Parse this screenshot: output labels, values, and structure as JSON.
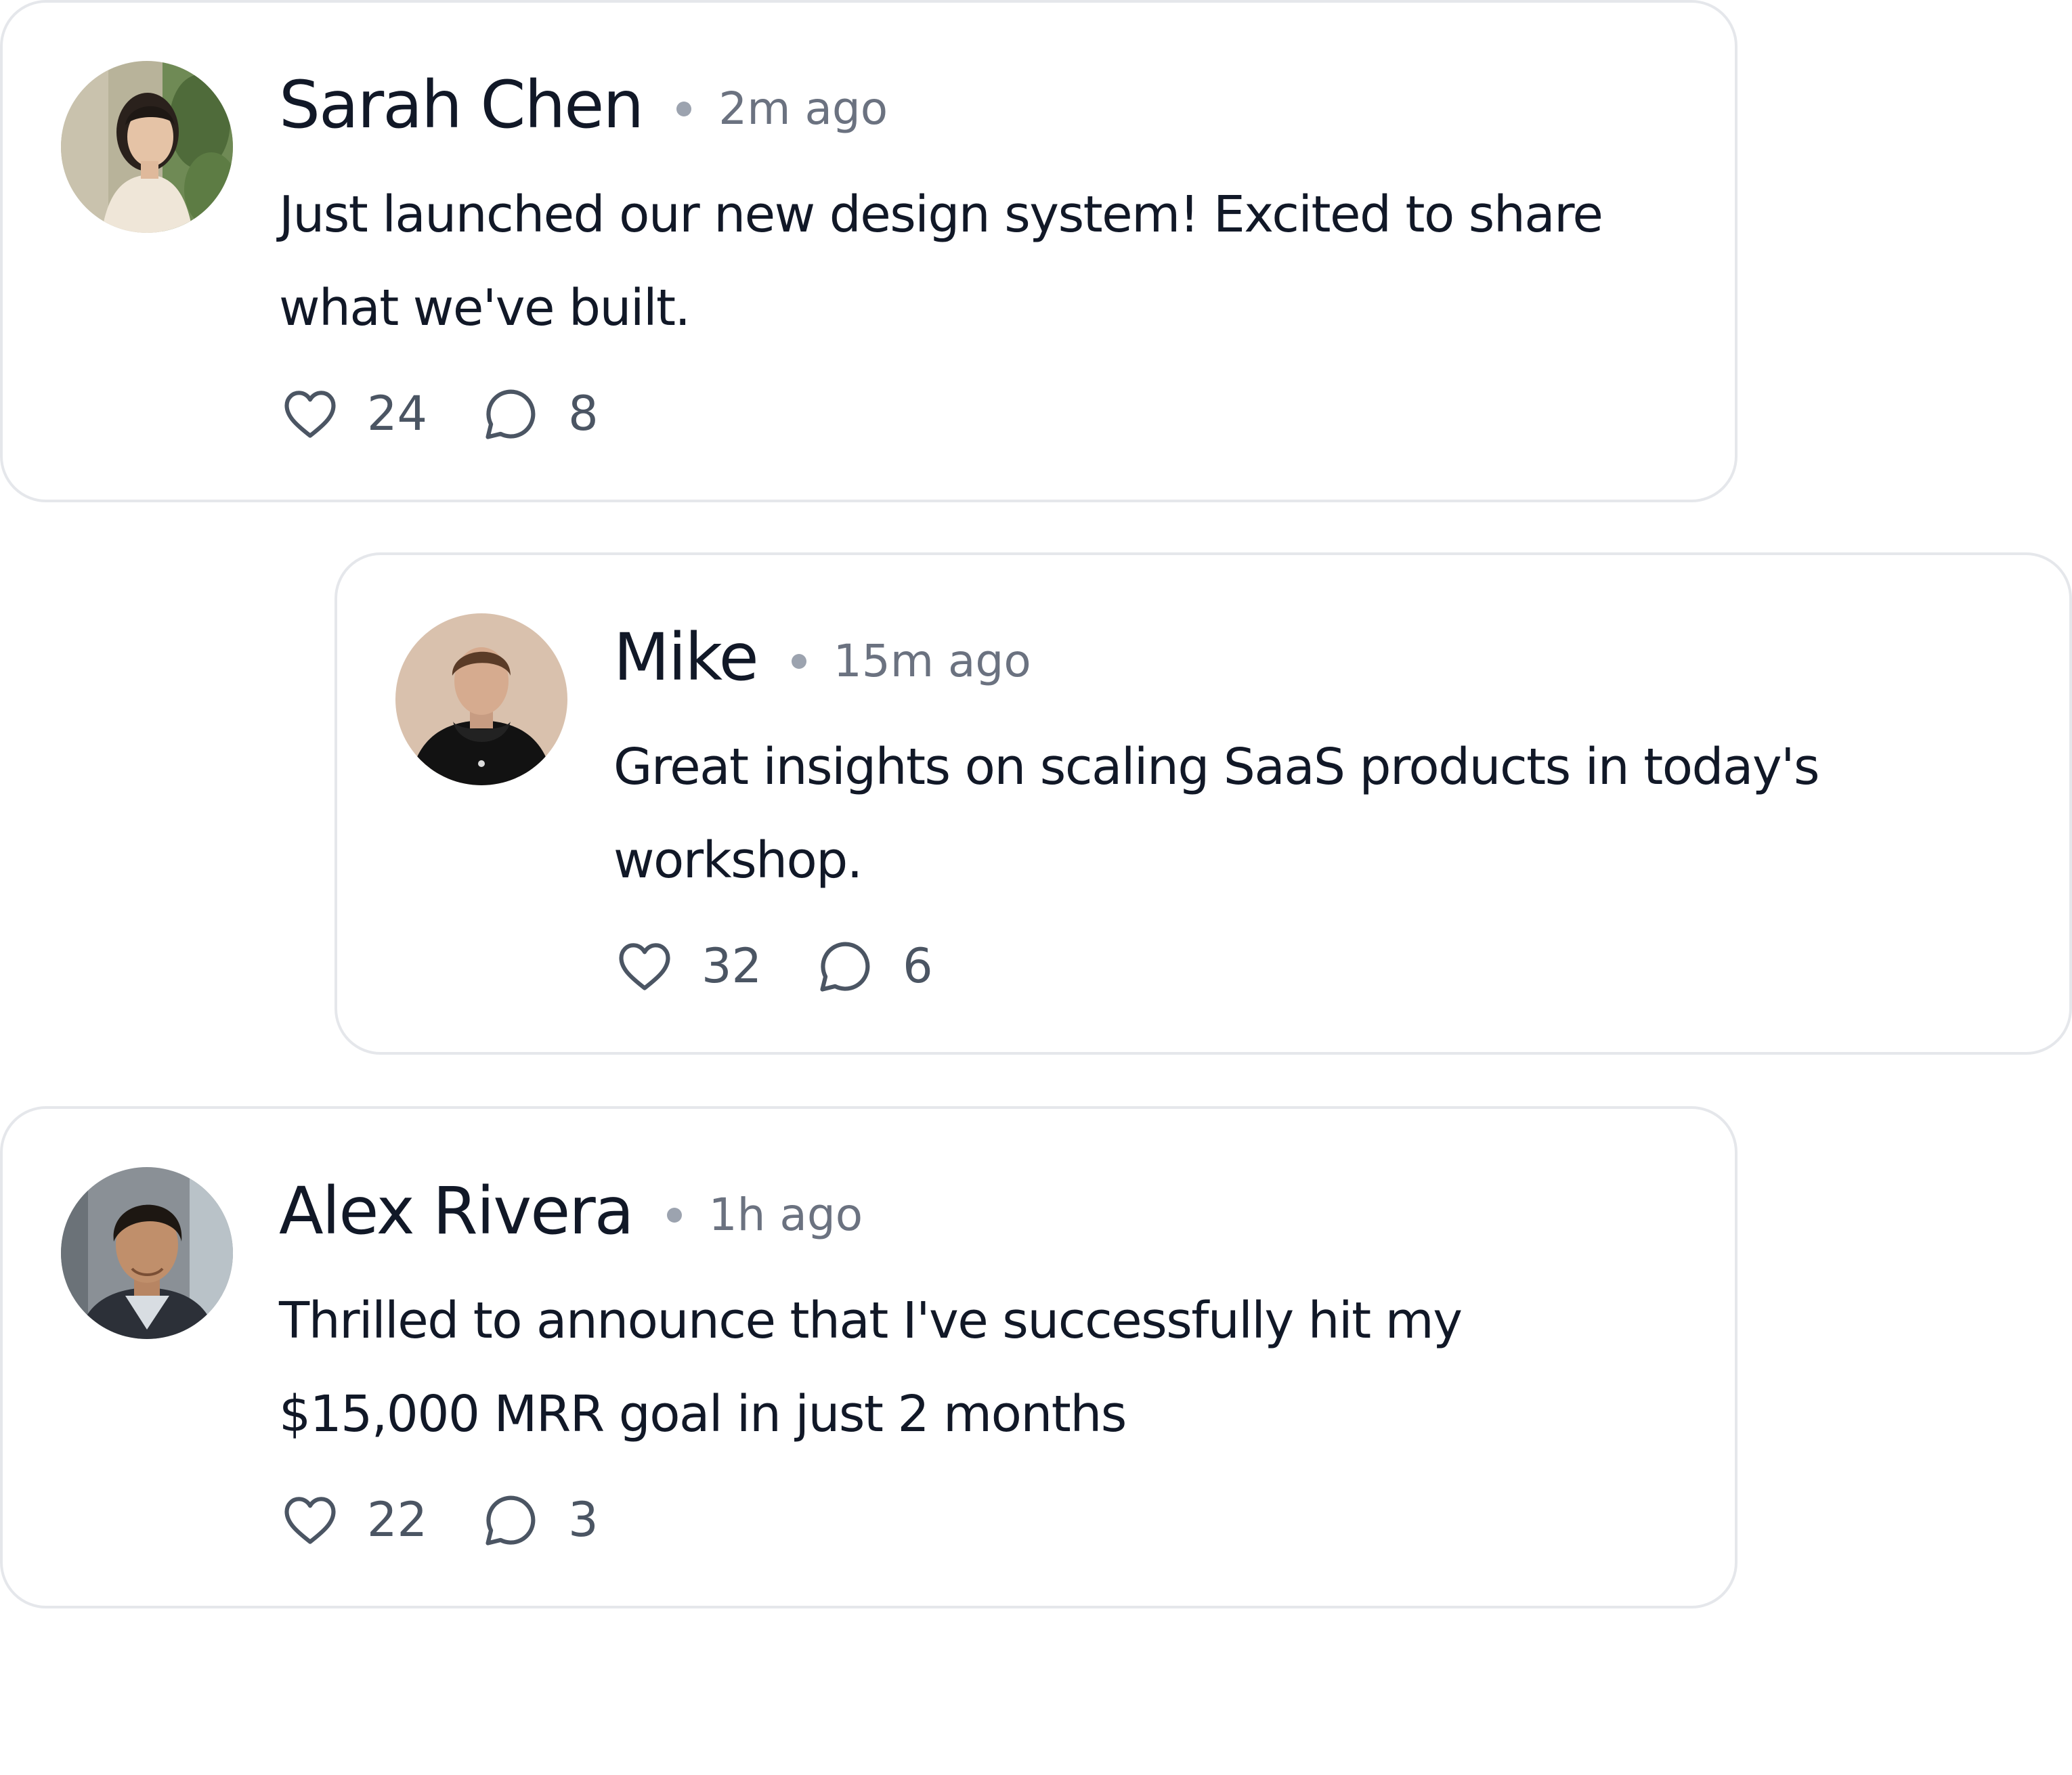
{
  "posts": [
    {
      "author": "Sarah Chen",
      "time": "2m ago",
      "text": "Just launched our new design system! Excited to share what we've built.",
      "likes": "24",
      "comments": "8",
      "avatar_icon": "avatar-sarah-chen-photo"
    },
    {
      "author": "Mike",
      "time": "15m ago",
      "text": "Great insights on scaling SaaS products in today's workshop.",
      "likes": "32",
      "comments": "6",
      "avatar_icon": "avatar-mike-photo"
    },
    {
      "author": "Alex Rivera",
      "time": "1h ago",
      "text": "Thrilled to announce that I've successfully hit my $15,000 MRR goal in just 2 months",
      "likes": "22",
      "comments": "3",
      "avatar_icon": "avatar-alex-rivera-photo"
    }
  ],
  "icons": {
    "like": "heart-icon",
    "comment": "speech-bubble-icon"
  },
  "colors": {
    "name": "#111827",
    "meta": "#6b7280",
    "icon": "#4b5563",
    "border": "#e5e7eb"
  }
}
